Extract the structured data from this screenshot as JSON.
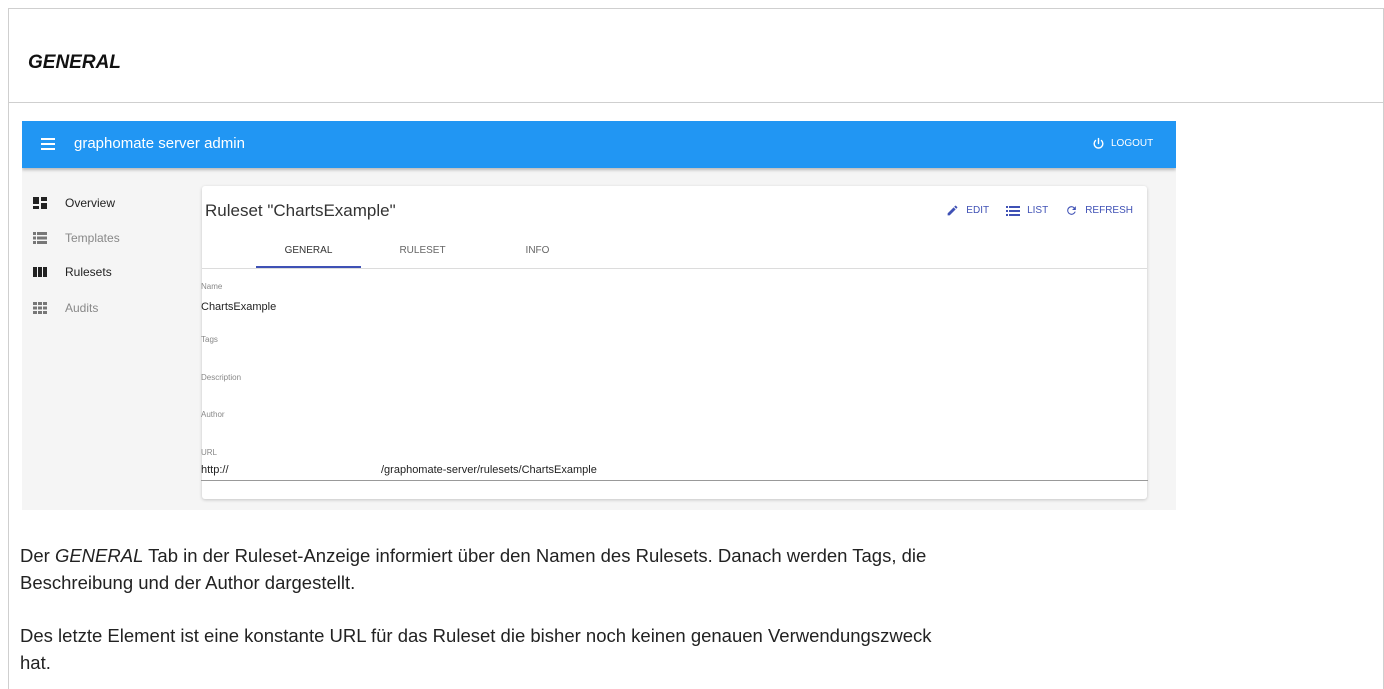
{
  "section_heading": "GENERAL",
  "app": {
    "title": "graphomate server admin",
    "logout_label": "LOGOUT"
  },
  "nav": {
    "items": [
      {
        "label": "Overview",
        "icon": "dashboard-icon",
        "active": true
      },
      {
        "label": "Templates",
        "icon": "list-view-icon",
        "active": false
      },
      {
        "label": "Rulesets",
        "icon": "columns-icon",
        "active": true
      },
      {
        "label": "Audits",
        "icon": "grid-icon",
        "active": false
      }
    ]
  },
  "card": {
    "title": "Ruleset \"ChartsExample\"",
    "actions": {
      "edit": "EDIT",
      "list": "LIST",
      "refresh": "REFRESH"
    },
    "tabs": [
      {
        "label": "GENERAL",
        "active": true
      },
      {
        "label": "RULESET",
        "active": false
      },
      {
        "label": "INFO",
        "active": false
      }
    ],
    "fields": {
      "name_label": "Name",
      "name_value": "ChartsExample",
      "tags_label": "Tags",
      "description_label": "Description",
      "author_label": "Author",
      "url_label": "URL",
      "url_prefix": "http://",
      "url_path": "/graphomate-server/rulesets/ChartsExample"
    }
  },
  "description": {
    "p1_pre": "Der ",
    "p1_em": "GENERAL",
    "p1_line1_rest": " Tab in der Ruleset-Anzeige informiert über den Namen des Rulesets. Danach werden Tags, die",
    "p1_line2": "Beschreibung und der Author dargestellt.",
    "p2_line1": "Des letzte Element ist eine konstante URL für das Ruleset die bisher noch keinen genauen Verwendungszweck",
    "p2_line2": "hat."
  },
  "colors": {
    "appbar": "#2196f3",
    "accent": "#3f51b5"
  }
}
